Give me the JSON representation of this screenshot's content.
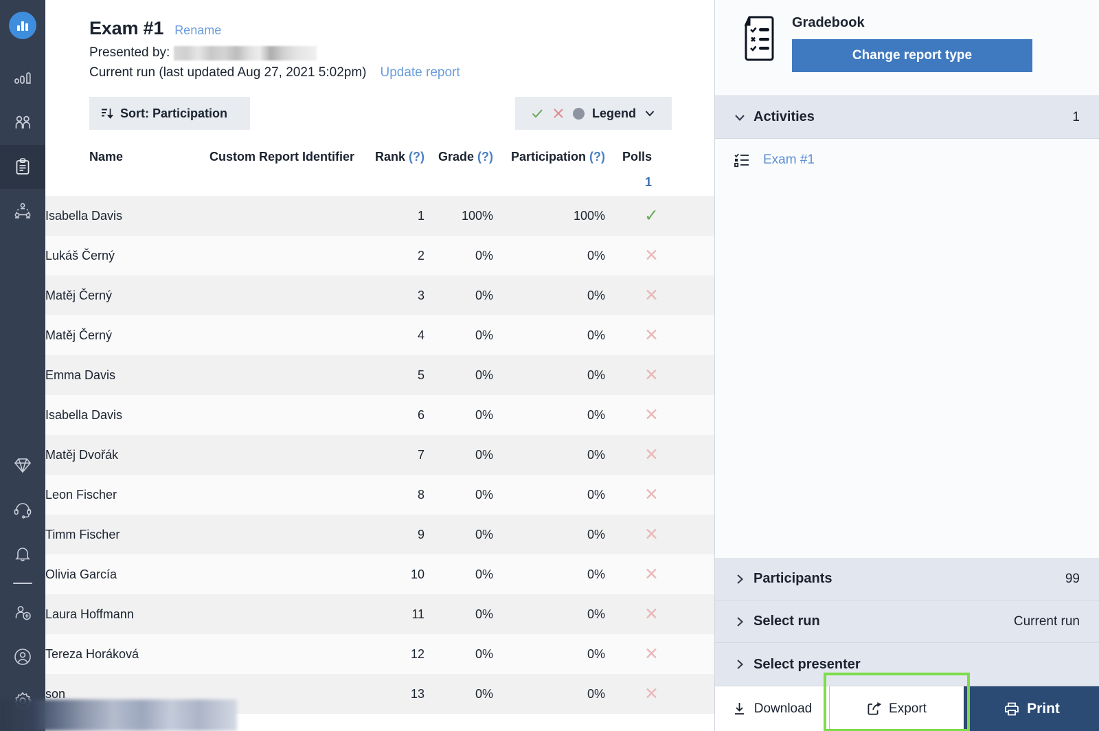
{
  "sidebar": {
    "logo": "bar-chart-logo",
    "items": [
      {
        "icon": "analytics-icon",
        "name": "analytics"
      },
      {
        "icon": "people-icon",
        "name": "people"
      },
      {
        "icon": "clipboard-icon",
        "name": "reports",
        "active": true
      },
      {
        "icon": "network-users-icon",
        "name": "groups"
      },
      {
        "icon": "diamond-icon",
        "name": "upgrade"
      },
      {
        "icon": "headset-icon",
        "name": "support"
      },
      {
        "icon": "bell-icon",
        "name": "notifications"
      },
      {
        "icon": "add-user-icon",
        "name": "invite"
      },
      {
        "icon": "account-circle-icon",
        "name": "account"
      },
      {
        "icon": "gear-icon",
        "name": "settings"
      }
    ]
  },
  "report": {
    "title": "Exam #1",
    "rename_label": "Rename",
    "presented_by_label": "Presented by:",
    "presented_by_value": "",
    "run_info": "Current run (last updated Aug 27, 2021 5:02pm)",
    "update_link": "Update report"
  },
  "toolbar": {
    "sort_label": "Sort: Participation",
    "sort_icon": "sort-descending-icon",
    "legend_label": "Legend",
    "legend_chevron": "chevron-down-icon",
    "legend_check_icon": "check-icon",
    "legend_x_icon": "x-icon",
    "legend_dot_icon": "circle-icon"
  },
  "table": {
    "columns": [
      {
        "key": "name",
        "label": "Name",
        "help": false
      },
      {
        "key": "cri",
        "label": "Custom Report Identifier",
        "help": false
      },
      {
        "key": "rank",
        "label": "Rank",
        "help": true
      },
      {
        "key": "grade",
        "label": "Grade",
        "help": true
      },
      {
        "key": "participation",
        "label": "Participation",
        "help": true
      },
      {
        "key": "polls",
        "label": "Polls",
        "help": false
      }
    ],
    "help_marker": "(?)",
    "polls_subheader": "1",
    "rows": [
      {
        "name": "Isabella Davis",
        "cri": "",
        "rank": "1",
        "grade": "100%",
        "participation": "100%",
        "poll_status": "check"
      },
      {
        "name": "Lukáš Černý",
        "cri": "",
        "rank": "2",
        "grade": "0%",
        "participation": "0%",
        "poll_status": "x"
      },
      {
        "name": "Matěj Černý",
        "cri": "",
        "rank": "3",
        "grade": "0%",
        "participation": "0%",
        "poll_status": "x"
      },
      {
        "name": "Matěj Černý",
        "cri": "",
        "rank": "4",
        "grade": "0%",
        "participation": "0%",
        "poll_status": "x"
      },
      {
        "name": "Emma Davis",
        "cri": "",
        "rank": "5",
        "grade": "0%",
        "participation": "0%",
        "poll_status": "x"
      },
      {
        "name": "Isabella Davis",
        "cri": "",
        "rank": "6",
        "grade": "0%",
        "participation": "0%",
        "poll_status": "x"
      },
      {
        "name": "Matěj Dvořák",
        "cri": "",
        "rank": "7",
        "grade": "0%",
        "participation": "0%",
        "poll_status": "x"
      },
      {
        "name": "Leon Fischer",
        "cri": "",
        "rank": "8",
        "grade": "0%",
        "participation": "0%",
        "poll_status": "x"
      },
      {
        "name": "Timm Fischer",
        "cri": "",
        "rank": "9",
        "grade": "0%",
        "participation": "0%",
        "poll_status": "x"
      },
      {
        "name": "Olivia García",
        "cri": "",
        "rank": "10",
        "grade": "0%",
        "participation": "0%",
        "poll_status": "x"
      },
      {
        "name": "Laura Hoffmann",
        "cri": "",
        "rank": "11",
        "grade": "0%",
        "participation": "0%",
        "poll_status": "x"
      },
      {
        "name": "Tereza Horáková",
        "cri": "",
        "rank": "12",
        "grade": "0%",
        "participation": "0%",
        "poll_status": "x"
      },
      {
        "name": "son",
        "cri": "",
        "rank": "13",
        "grade": "0%",
        "participation": "0%",
        "poll_status": "x"
      }
    ]
  },
  "right_panel": {
    "report_type_title": "Gradebook",
    "report_type_icon": "gradebook-document-icon",
    "change_report_button": "Change report type",
    "sections": [
      {
        "label": "Activities",
        "value": "1",
        "expanded": true
      },
      {
        "label": "Participants",
        "value": "99",
        "expanded": false
      },
      {
        "label": "Select run",
        "value": "Current run",
        "expanded": false
      },
      {
        "label": "Select presenter",
        "value": "",
        "expanded": false
      }
    ],
    "activities": [
      {
        "label": "Exam #1",
        "icon": "checklist-icon"
      }
    ],
    "actions": {
      "download": "Download",
      "download_icon": "download-icon",
      "export": "Export",
      "export_icon": "share-export-icon",
      "print": "Print",
      "print_icon": "printer-icon"
    }
  },
  "colors": {
    "sidebar_bg": "#343f52",
    "accent_blue": "#3f7ac0",
    "link_blue": "#5b8fd4",
    "print_navy": "#2b4a74",
    "highlight_green": "#7ddc4a",
    "check_green": "#69aa5a",
    "x_red": "#e9b9b9",
    "section_bg": "#e2e6ee"
  }
}
